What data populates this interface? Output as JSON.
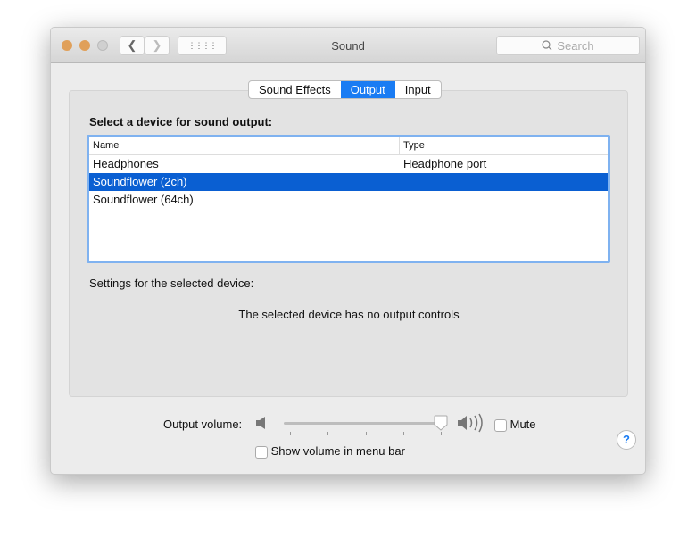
{
  "window": {
    "title": "Sound",
    "search_placeholder": "Search"
  },
  "tabs": [
    {
      "label": "Sound Effects"
    },
    {
      "label": "Output"
    },
    {
      "label": "Input"
    }
  ],
  "selected_tab": "Output",
  "output": {
    "heading": "Select a device for sound output:",
    "columns": [
      "Name",
      "Type"
    ],
    "devices": [
      {
        "name": "Headphones",
        "type": "Headphone port"
      },
      {
        "name": "Soundflower (2ch)",
        "type": ""
      },
      {
        "name": "Soundflower (64ch)",
        "type": ""
      }
    ],
    "selected_index": 1,
    "settings_label": "Settings for the selected device:",
    "no_controls": "The selected device has no output controls",
    "help": "?"
  },
  "volume": {
    "label": "Output volume:",
    "level": 1.0,
    "mute_label": "Mute",
    "mute_checked": false,
    "show_in_menu_bar_label": "Show volume in menu bar",
    "show_in_menu_bar_checked": false
  },
  "colors": {
    "accent": "#1a7cf3",
    "selection": "#0a5fd2"
  }
}
